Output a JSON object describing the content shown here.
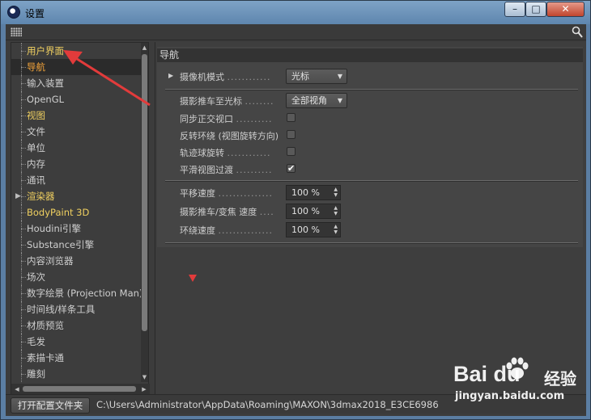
{
  "window": {
    "title": "设置"
  },
  "sidebar": {
    "items": [
      {
        "label": "用户界面",
        "color": "yellow"
      },
      {
        "label": "导航",
        "color": "orange",
        "selected": true
      },
      {
        "label": "输入装置",
        "color": "normal"
      },
      {
        "label": "OpenGL",
        "color": "normal"
      },
      {
        "label": "视图",
        "color": "yellow"
      },
      {
        "label": "文件",
        "color": "normal"
      },
      {
        "label": "单位",
        "color": "normal"
      },
      {
        "label": "内存",
        "color": "normal"
      },
      {
        "label": "通讯",
        "color": "normal"
      },
      {
        "label": "渲染器",
        "color": "yellow",
        "expandable": true
      },
      {
        "label": "BodyPaint 3D",
        "color": "yellow"
      },
      {
        "label": "Houdini引擎",
        "color": "normal"
      },
      {
        "label": "Substance引擎",
        "color": "normal"
      },
      {
        "label": "内容浏览器",
        "color": "normal"
      },
      {
        "label": "场次",
        "color": "normal"
      },
      {
        "label": "数字绘景 (Projection Man)",
        "color": "normal"
      },
      {
        "label": "时间线/样条工具",
        "color": "normal"
      },
      {
        "label": "材质预览",
        "color": "normal"
      },
      {
        "label": "毛发",
        "color": "normal"
      },
      {
        "label": "素描卡通",
        "color": "normal"
      },
      {
        "label": "雕刻",
        "color": "normal"
      }
    ]
  },
  "panel": {
    "header": "导航",
    "camera_mode": {
      "label": "摄像机模式",
      "dots": "............",
      "value": "光标"
    },
    "dolly_to_cursor": {
      "label": "摄影推车至光标",
      "dots": "........",
      "value": "全部视角"
    },
    "sync_ortho": {
      "label": "同步正交视口",
      "dots": "..........",
      "checked": false
    },
    "reverse_orbit": {
      "label": "反转环绕 (视图旋转方向)",
      "checked": false
    },
    "trackball": {
      "label": "轨迹球旋转",
      "dots": "............",
      "checked": false
    },
    "smooth_transition": {
      "label": "平滑视图过渡",
      "dots": "..........",
      "checked": true
    },
    "pan_speed": {
      "label": "平移速度",
      "dots": "...............",
      "value": "100 %"
    },
    "dolly_speed": {
      "label": "摄影推车/变焦 速度",
      "dots": "....",
      "value": "100 %"
    },
    "orbit_speed": {
      "label": "环绕速度",
      "dots": "...............",
      "value": "100 %"
    }
  },
  "footer": {
    "open_folder_label": "打开配置文件夹",
    "path": "C:\\Users\\Administrator\\AppData\\Roaming\\MAXON\\3dmax2018_E3CE6986"
  },
  "watermark": {
    "logo": "Bai du",
    "cn": "经验",
    "url": "jingyan.baidu.com"
  },
  "colors": {
    "yellow_label": "#f0d060",
    "orange_label": "#f7a63a",
    "annotation_red": "#e23b3b"
  }
}
